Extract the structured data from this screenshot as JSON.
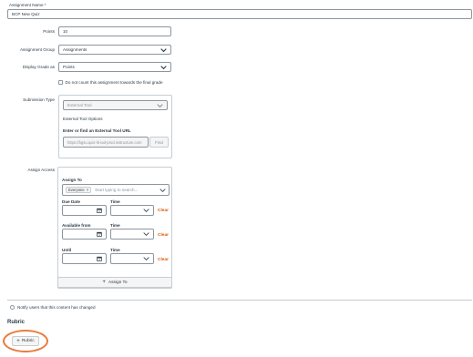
{
  "form": {
    "assignment_name_label": "Assignment Name *",
    "assignment_name_value": "BCP New Quiz",
    "points_label": "Points",
    "points_value": "10",
    "group_label": "Assignment Group",
    "group_value": "Assignments",
    "display_label": "Display Grade as",
    "display_value": "Points",
    "final_grade_checkbox_label": "Do not count this assignment towards the final grade"
  },
  "submission": {
    "label": "Submission Type",
    "type_value": "External Tool",
    "options_heading": "External Tool Options",
    "url_heading": "Enter or find an External Tool URL",
    "url_value": "https://bgsu.quiz-lti-iad-prod.instructure.com",
    "find_label": "Find"
  },
  "assign": {
    "section_label": "Assign Access",
    "assign_to_label": "Assign To",
    "chip_label": "Everyone",
    "search_placeholder": "Start typing to search...",
    "due_date_label": "Due Date",
    "available_from_label": "Available from",
    "until_label": "Until",
    "time_label": "Time",
    "clear_label": "Clear",
    "add_button_label": "Assign To"
  },
  "notify_label": "Notify users that this content has changed",
  "rubric": {
    "heading": "Rubric",
    "button_label": "Rubric"
  },
  "colors": {
    "accent_orange": "#d95a0e",
    "highlight_circle": "#e87d3e"
  }
}
